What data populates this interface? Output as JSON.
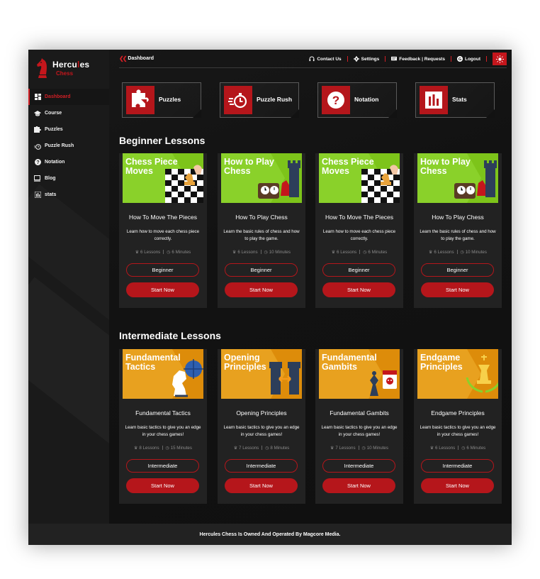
{
  "brand": {
    "title_pre": "Hercu",
    "title_mark": "l",
    "title_post": "es",
    "subtitle": "Chess"
  },
  "sidebar": {
    "items": [
      {
        "label": "Dashboard",
        "icon": "dashboard-icon",
        "active": true
      },
      {
        "label": "Course",
        "icon": "graduation-cap-icon"
      },
      {
        "label": "Puzzles",
        "icon": "puzzle-icon"
      },
      {
        "label": "Puzzle Rush",
        "icon": "timer-icon"
      },
      {
        "label": "Notation",
        "icon": "question-icon"
      },
      {
        "label": "Blog",
        "icon": "monitor-icon"
      },
      {
        "label": "stats",
        "icon": "bar-chart-icon"
      }
    ]
  },
  "topbar": {
    "breadcrumb": "Dashboard",
    "links": [
      {
        "label": "Contact Us",
        "icon": "headset-icon"
      },
      {
        "label": "Settings",
        "icon": "gear-icon"
      },
      {
        "label": "Feedback | Requests",
        "icon": "message-icon"
      },
      {
        "label": "Logout",
        "icon": "logout-icon"
      }
    ],
    "theme_icon": "sun-icon"
  },
  "tiles": [
    {
      "label": "Puzzles",
      "icon": "puzzle-icon"
    },
    {
      "label": "Puzzle Rush",
      "icon": "stopwatch-icon"
    },
    {
      "label": "Notation",
      "icon": "question-icon"
    },
    {
      "label": "Stats",
      "icon": "bar-chart-icon"
    }
  ],
  "beginner": {
    "title": "Beginner Lessons",
    "cards": [
      {
        "thumb_text": "Chess Piece Moves",
        "title": "How To Move The Pieces",
        "desc": "Learn how to move each chess piece correctly.",
        "lessons": "6 Lessons",
        "minutes": "6 Minutes",
        "level": "Beginner",
        "cta": "Start Now"
      },
      {
        "thumb_text": "How to Play Chess",
        "title": "How To Play Chess",
        "desc": "Learn the basic rules of chess and how to play the game.",
        "lessons": "6 Lessons",
        "minutes": "10 Minutes",
        "level": "Beginner",
        "cta": "Start Now"
      },
      {
        "thumb_text": "Chess Piece Moves",
        "title": "How To Move The Pieces",
        "desc": "Learn how to move each chess piece correctly.",
        "lessons": "6 Lessons",
        "minutes": "6 Minutes",
        "level": "Beginner",
        "cta": "Start Now"
      },
      {
        "thumb_text": "How to Play Chess",
        "title": "How To Play Chess",
        "desc": "Learn the basic rules of chess and how to play the game.",
        "lessons": "6 Lessons",
        "minutes": "10 Minutes",
        "level": "Beginner",
        "cta": "Start Now"
      }
    ]
  },
  "intermediate": {
    "title": "Intermediate Lessons",
    "cards": [
      {
        "thumb_text": "Fundamental Tactics",
        "title": "Fundamental Tactics",
        "desc": "Learn basic tactics to give you an edge in your chess games!",
        "lessons": "8 Lessons",
        "minutes": "15 Minutes",
        "level": "Intermediate",
        "cta": "Start Now"
      },
      {
        "thumb_text": "Opening Principles",
        "title": "Opening Principles",
        "desc": "Learn basic tactics to give you an edge in your chess games!",
        "lessons": "7 Lessons",
        "minutes": "8 Minutes",
        "level": "Intermediate",
        "cta": "Start Now"
      },
      {
        "thumb_text": "Fundamental Gambits",
        "title": "Fundamental Gambits",
        "desc": "Learn basic tactics to give you an edge in your chess games!",
        "lessons": "7 Lessons",
        "minutes": "10 Minutes",
        "level": "Intermediate",
        "cta": "Start Now"
      },
      {
        "thumb_text": "Endgame Principles",
        "title": "Endgame Principles",
        "desc": "Learn basic tactics to give you an edge in your chess games!",
        "lessons": "6 Lessons",
        "minutes": "6 Minutes",
        "level": "Intermediate",
        "cta": "Start Now"
      }
    ]
  },
  "footer": {
    "text": "Hercules Chess Is Owned And Operated By Magcore Media."
  },
  "colors": {
    "accent": "#c4161c",
    "beginner_thumb": "#7dc41a",
    "intermediate_thumb": "#e08e0b"
  }
}
